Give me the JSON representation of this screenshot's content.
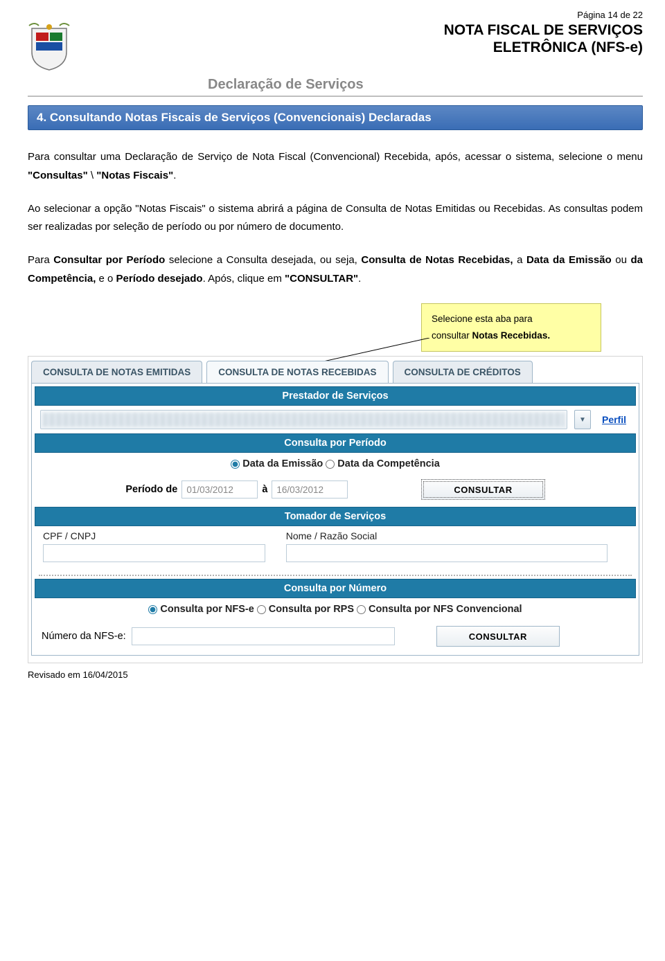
{
  "page_number": "Página 14 de 22",
  "doc_title": "NOTA FISCAL DE SERVIÇOS\nELETRÔNICA (NFS-e)",
  "doc_subtitle": "Declaração de Serviços",
  "section_heading": "4.   Consultando Notas Fiscais de Serviços (Convencionais) Declaradas",
  "paragraphs": {
    "p1_a": "Para consultar uma Declaração de Serviço de Nota Fiscal (Convencional) Recebida, após, acessar o sistema, selecione o menu ",
    "p1_b": "\"Consultas\"",
    "p1_c": " \\ ",
    "p1_d": "\"Notas Fiscais\"",
    "p1_e": ".",
    "p2": "Ao selecionar a opção \"Notas Fiscais\" o sistema abrirá a página de Consulta de Notas Emitidas ou Recebidas. As consultas podem ser realizadas por seleção de período ou por número de documento.",
    "p3_a": "Para ",
    "p3_b": "Consultar por Período",
    "p3_c": " selecione a Consulta desejada, ou seja, ",
    "p3_d": "Consulta de Notas Recebidas,",
    "p3_e": " a ",
    "p3_f": "Data da Emissão",
    "p3_g": " ou ",
    "p3_h": "da Competência,",
    "p3_i": " e o ",
    "p3_j": "Período desejado",
    "p3_k": ". Após, clique em ",
    "p3_l": "\"CONSULTAR\"",
    "p3_m": "."
  },
  "callout": {
    "line1": "Selecione esta aba para",
    "line2_a": "consultar ",
    "line2_b": "Notas Recebidas."
  },
  "ui": {
    "tabs": {
      "emitidas": "CONSULTA DE NOTAS EMITIDAS",
      "recebidas": "CONSULTA DE NOTAS RECEBIDAS",
      "creditos": "CONSULTA DE CRÉDITOS"
    },
    "bands": {
      "prestador": "Prestador de Serviços",
      "periodo": "Consulta por Período",
      "tomador": "Tomador de Serviços",
      "numero": "Consulta por Número"
    },
    "perfil_link": "Perfil",
    "radio_periodo": {
      "emissao": "Data da Emissão",
      "competencia": "Data da Competência"
    },
    "periodo_label_de": "Período de",
    "periodo_label_a": "à",
    "date_from": "01/03/2012",
    "date_to": "16/03/2012",
    "consultar_btn": "CONSULTAR",
    "tomador_labels": {
      "cpf": "CPF / CNPJ",
      "nome": "Nome / Razão Social"
    },
    "radio_numero": {
      "nfse": "Consulta por NFS-e",
      "rps": "Consulta por RPS",
      "conv": "Consulta por NFS Convencional"
    },
    "numero_label": "Número da NFS-e:"
  },
  "footer": "Revisado em 16/04/2015"
}
